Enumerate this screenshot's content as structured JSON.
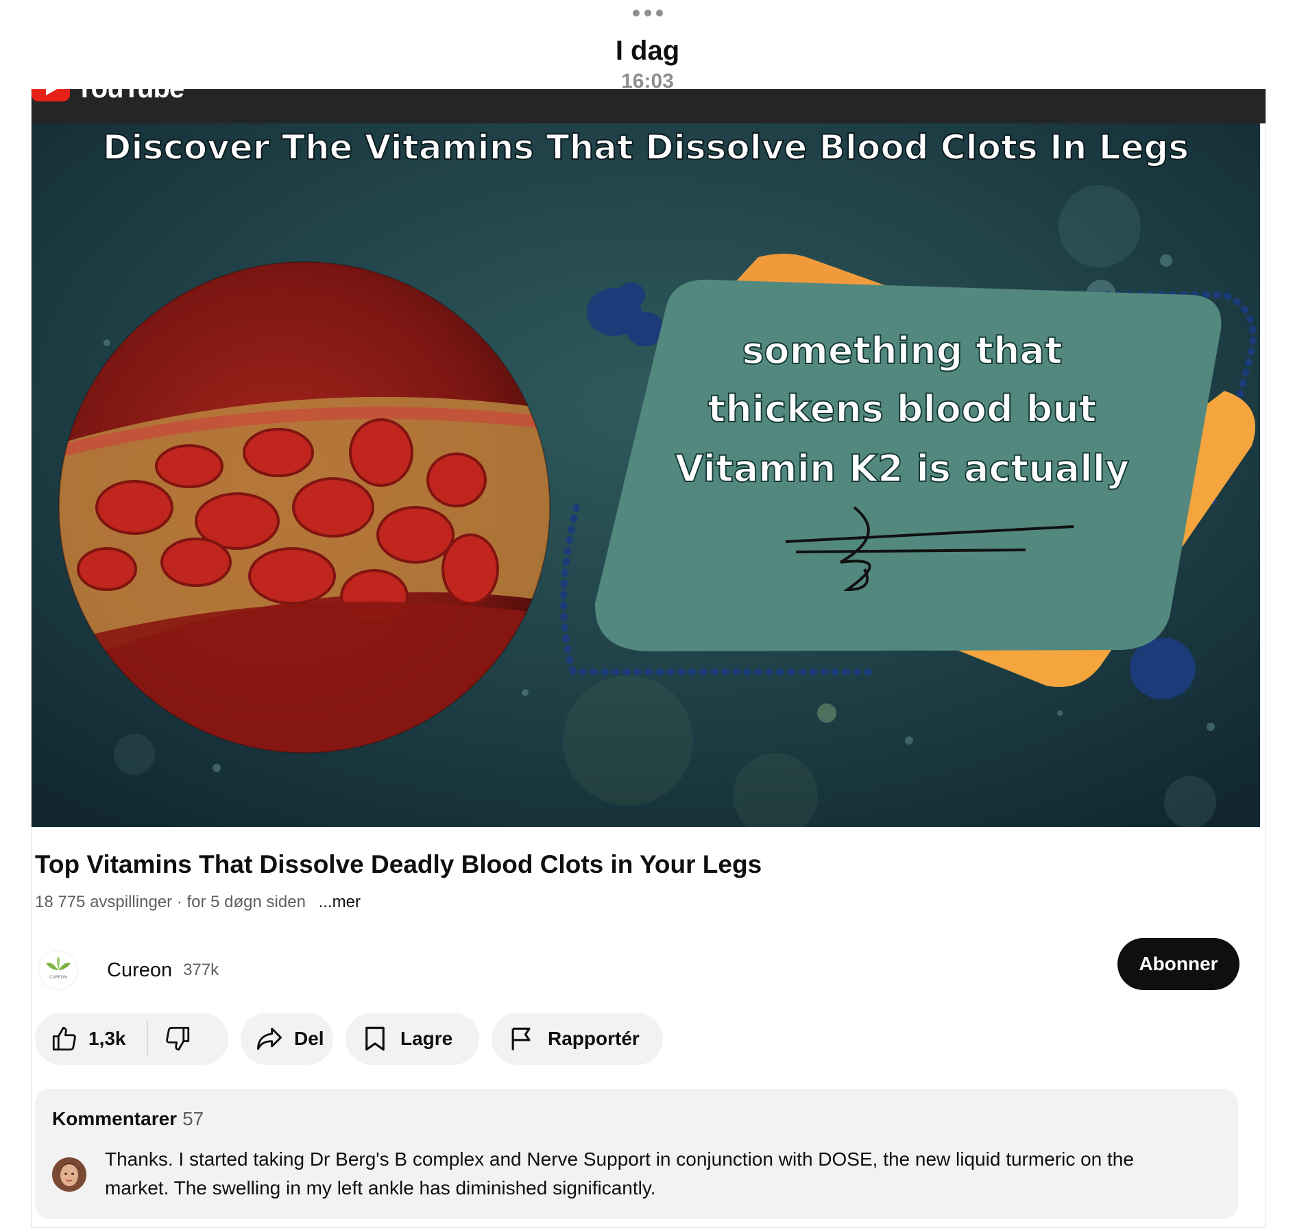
{
  "header": {
    "day": "I dag",
    "time": "16:03"
  },
  "brand": {
    "word": "YouTube",
    "accent": "#e62117"
  },
  "thumbnail": {
    "headline": "Discover The Vitamins That Dissolve Blood Clots In Legs",
    "bubble_lines": [
      "something that",
      "thickens blood but",
      "Vitamin K2 is actually"
    ]
  },
  "video": {
    "title": "Top Vitamins That Dissolve Deadly Blood Clots in Your Legs",
    "views": "18 775 avspillinger",
    "age": "· for 5 døgn siden",
    "more": "...mer"
  },
  "channel": {
    "name": "Cureon",
    "subscribers": "377k",
    "avatar_text": "CUREON",
    "subscribe_label": "Abonner"
  },
  "actions": {
    "likes": "1,3k",
    "share": "Del",
    "save": "Lagre",
    "report": "Rapportér"
  },
  "comments": {
    "label": "Kommentarer",
    "count": "57",
    "top_comment": "Thanks. I started taking Dr Berg's B complex and Nerve Support in conjunction with DOSE, the new liquid turmeric on the market. The swelling in my left ankle has diminished significantly."
  },
  "icons": [
    "play-logo-icon",
    "like-icon",
    "dislike-icon",
    "share-icon",
    "save-icon",
    "report-flag-icon"
  ]
}
